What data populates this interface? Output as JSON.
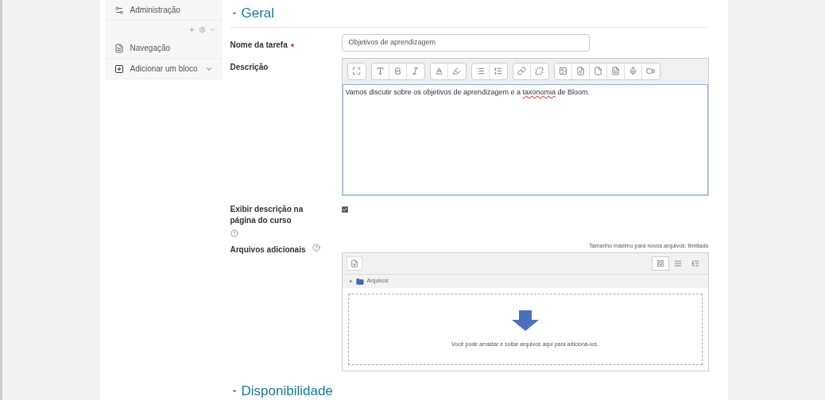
{
  "sidebar": {
    "items": [
      {
        "label": "Administração",
        "kind": "admin"
      },
      {
        "label": "Navegação",
        "kind": "nav"
      },
      {
        "label": "Adicionar um bloco",
        "kind": "add"
      }
    ]
  },
  "sections": [
    {
      "title": "Geral",
      "expanded": true
    },
    {
      "title": "Disponibilidade",
      "expanded": true
    }
  ],
  "form": {
    "name": {
      "label": "Nome da tarefa",
      "required": true,
      "value": "Objetivos de aprendizagem"
    },
    "description": {
      "label": "Descrição",
      "value_before": "Vamos discutir sobre os objetivos de aprendizagem e a ",
      "misspelled": "taxonomia",
      "value_after": " de Bloom."
    },
    "show_description": {
      "label": "Exibir descrição na página do curso",
      "checked": true
    },
    "files": {
      "label": "Arquivos adicionais",
      "max_size": "Tamanho máximo para novos arquivos: Ilimitado",
      "folder": "Arquivos",
      "drop_hint": "Você pode arrastar e soltar arquivos aqui para adicioná-los."
    }
  }
}
